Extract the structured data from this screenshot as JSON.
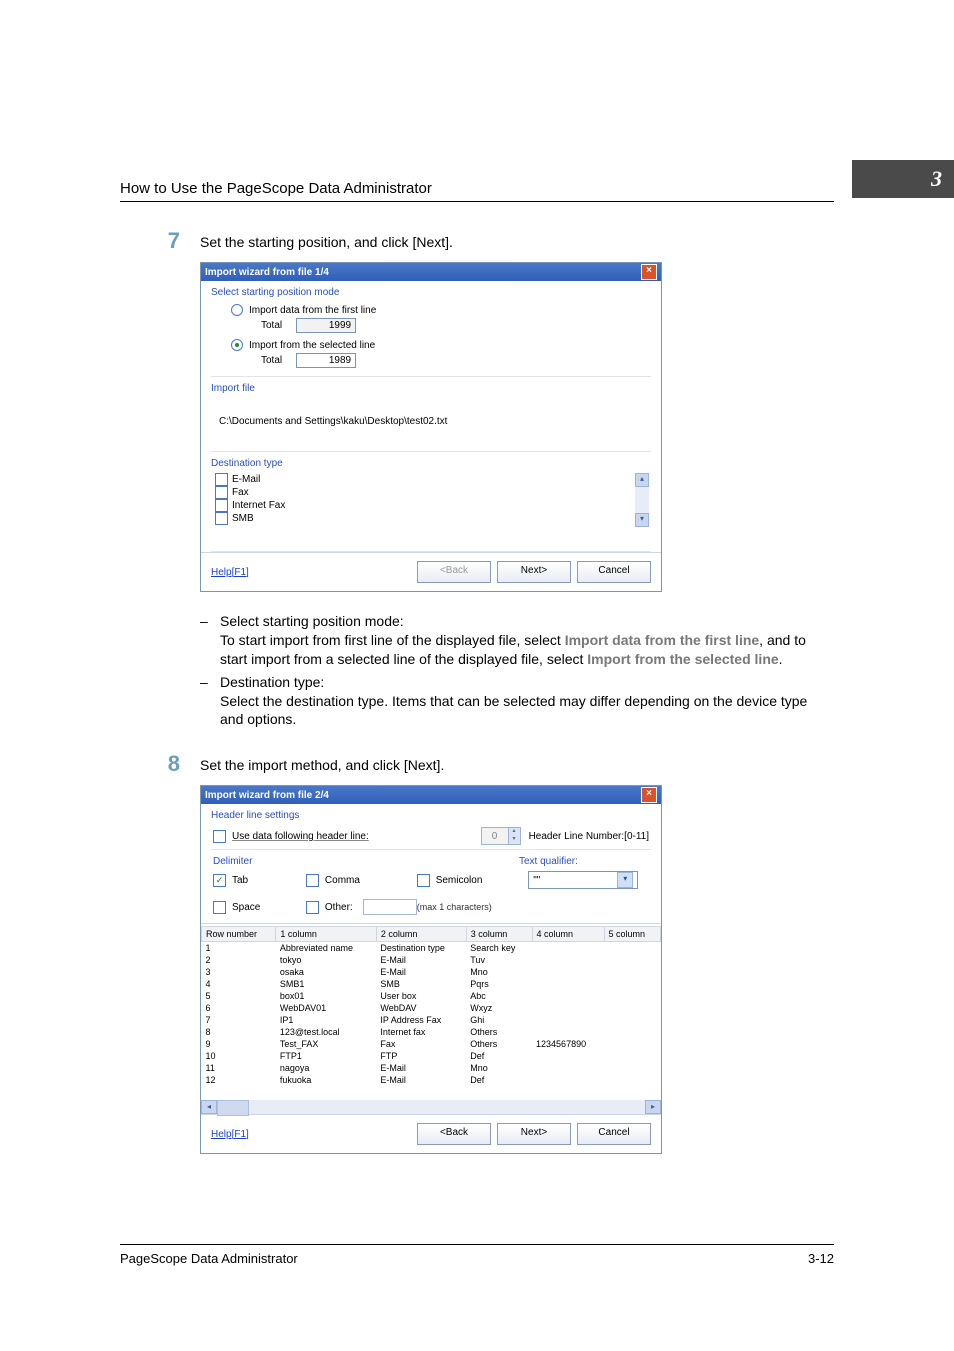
{
  "header": {
    "title": "How to Use the PageScope Data Administrator",
    "chapter": "3"
  },
  "step7": {
    "num": "7",
    "text": "Set the starting position, and click [Next]."
  },
  "dialog1": {
    "title": "Import wizard from file 1/4",
    "sections": {
      "starting_mode": "Select starting position mode",
      "import_file": "Import file",
      "destination_type": "Destination type"
    },
    "opt_first_line": "Import data from the first line",
    "opt_selected_line": "Import from the selected line",
    "total_label": "Total",
    "total1": "1999",
    "total2": "1989",
    "file_path": "C:\\Documents and Settings\\kaku\\Desktop\\test02.txt",
    "dest_items": [
      "E-Mail",
      "Fax",
      "Internet Fax",
      "SMB"
    ],
    "help": "Help[F1]",
    "back": "<Back",
    "next": "Next>",
    "cancel": "Cancel"
  },
  "explain": {
    "row1_label": "Select starting position mode:",
    "row1_body_a": "To start import from first line of the displayed file, select ",
    "row1_bold_a": "Import data from the first line",
    "row1_body_b": ", and to start import from a selected line of the displayed file, select ",
    "row1_bold_b": "Import from the selected line",
    "row1_body_c": ".",
    "row2_label": "Destination type:",
    "row2_body": "Select the destination type. Items that can be selected may differ depending on the device type and options."
  },
  "step8": {
    "num": "8",
    "text": "Set the import method, and click [Next]."
  },
  "dialog2": {
    "title": "Import wizard from file 2/4",
    "header_settings": "Header line settings",
    "use_header": "Use data following header line:",
    "header_spin_val": "0",
    "header_range": "Header Line Number:[0-11]",
    "delimiter": "Delimiter",
    "text_qualifier": "Text qualifier:",
    "tq_value": "\"\"",
    "tab": "Tab",
    "comma": "Comma",
    "semicolon": "Semicolon",
    "space": "Space",
    "other": "Other:",
    "max_note": "(max 1 characters)",
    "cols": [
      "Row number",
      "1 column",
      "2 column",
      "3 column",
      "4 column",
      "5 column"
    ],
    "help": "Help[F1]",
    "back": "<Back",
    "next": "Next>",
    "cancel": "Cancel"
  },
  "chart_data": {
    "type": "table",
    "columns": [
      "Row number",
      "1 column",
      "2 column",
      "3 column",
      "4 column",
      "5 column"
    ],
    "rows": [
      [
        "1",
        "Abbreviated name",
        "Destination type",
        "Search key",
        "",
        ""
      ],
      [
        "2",
        "tokyo",
        "E-Mail",
        "Tuv",
        "",
        ""
      ],
      [
        "3",
        "osaka",
        "E-Mail",
        "Mno",
        "",
        ""
      ],
      [
        "4",
        "SMB1",
        "SMB",
        "Pqrs",
        "",
        ""
      ],
      [
        "5",
        "box01",
        "User box",
        "Abc",
        "",
        ""
      ],
      [
        "6",
        "WebDAV01",
        "WebDAV",
        "Wxyz",
        "",
        ""
      ],
      [
        "7",
        "IP1",
        "IP Address Fax",
        "Ghi",
        "",
        ""
      ],
      [
        "8",
        "123@test.local",
        "Internet fax",
        "Others",
        "",
        ""
      ],
      [
        "9",
        "Test_FAX",
        "Fax",
        "Others",
        "1234567890",
        ""
      ],
      [
        "10",
        "FTP1",
        "FTP",
        "Def",
        "",
        ""
      ],
      [
        "11",
        "nagoya",
        "E-Mail",
        "Mno",
        "",
        ""
      ],
      [
        "12",
        "fukuoka",
        "E-Mail",
        "Def",
        "",
        ""
      ]
    ]
  },
  "footer": {
    "left": "PageScope Data Administrator",
    "right": "3-12"
  }
}
